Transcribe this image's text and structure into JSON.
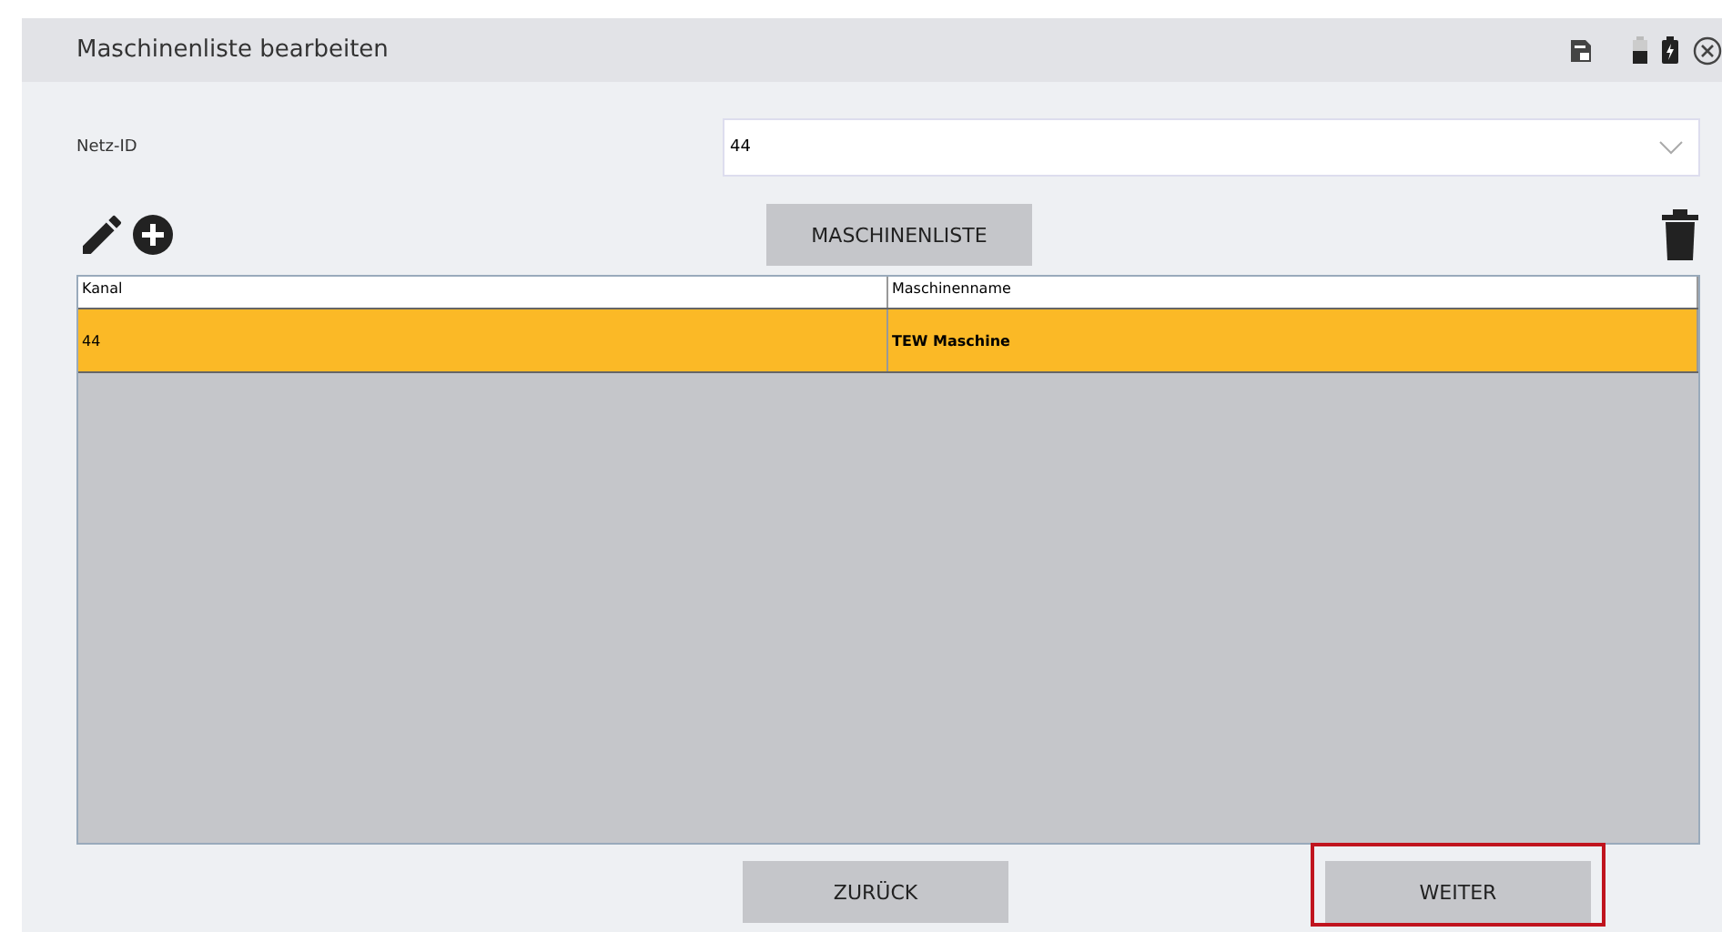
{
  "window": {
    "title": "Maschinenliste bearbeiten"
  },
  "net_id": {
    "label": "Netz-ID",
    "value": "44"
  },
  "toolbar": {
    "list_button": "MASCHINENLISTE"
  },
  "table": {
    "columns": [
      "Kanal",
      "Maschinenname"
    ],
    "rows": [
      {
        "cells": [
          "44",
          "TEW Maschine"
        ],
        "selected": true
      }
    ]
  },
  "buttons": [
    {
      "label": "ZURÜCK",
      "highlighted": false
    },
    {
      "label": "WEITER",
      "highlighted": true
    }
  ]
}
